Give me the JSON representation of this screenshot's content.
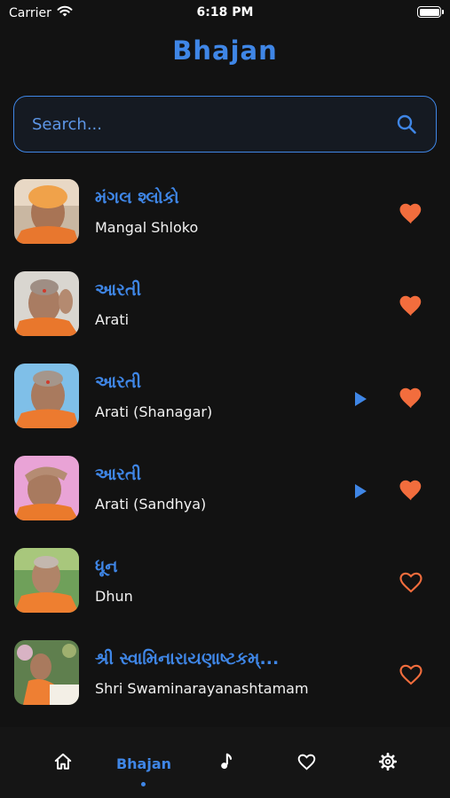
{
  "status_bar": {
    "carrier": "Carrier",
    "time": "6:18 PM"
  },
  "page": {
    "title": "Bhajan"
  },
  "search": {
    "placeholder": "Search...",
    "value": ""
  },
  "colors": {
    "accent": "#3f86e6",
    "heart": "#f26d3d",
    "background": "#121212"
  },
  "items": [
    {
      "title_gu": "મંગલ શ્લોકો",
      "title_en": "Mangal Shloko",
      "favorite": true,
      "has_play": false
    },
    {
      "title_gu": "આરતી",
      "title_en": "Arati",
      "favorite": true,
      "has_play": false
    },
    {
      "title_gu": "આરતી",
      "title_en": "Arati (Shanagar)",
      "favorite": true,
      "has_play": true
    },
    {
      "title_gu": "આરતી",
      "title_en": "Arati (Sandhya)",
      "favorite": true,
      "has_play": true
    },
    {
      "title_gu": "ધૂન",
      "title_en": "Dhun",
      "favorite": false,
      "has_play": false
    },
    {
      "title_gu": "શ્રી સ્વામિનારાયણાષ્ટકમ્...",
      "title_en": "Shri Swaminarayanashtamam",
      "favorite": false,
      "has_play": false
    }
  ],
  "tab_bar": {
    "tabs": [
      {
        "icon": "home-icon",
        "label": ""
      },
      {
        "icon": "",
        "label": "Bhajan",
        "active": true
      },
      {
        "icon": "music-note-icon",
        "label": ""
      },
      {
        "icon": "heart-outline-icon",
        "label": ""
      },
      {
        "icon": "gear-icon",
        "label": ""
      }
    ]
  }
}
